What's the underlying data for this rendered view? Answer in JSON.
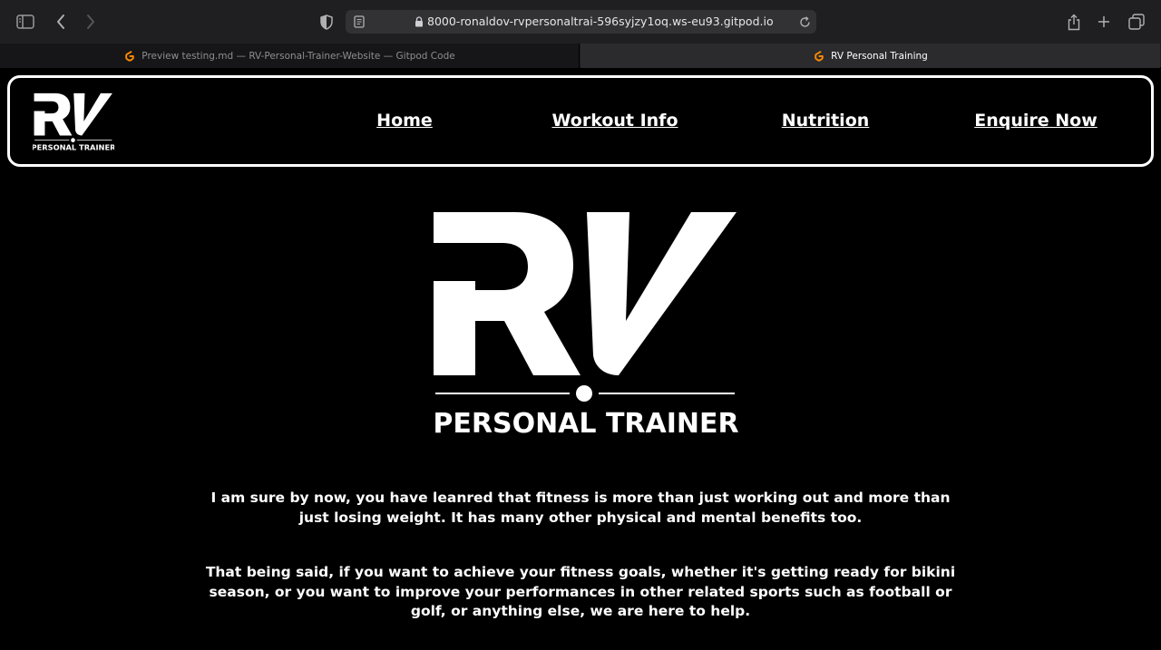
{
  "browser": {
    "url": "8000-ronaldov-rvpersonaltrai-596syjzy1oq.ws-eu93.gitpod.io",
    "tabs": [
      {
        "title": "Preview testing.md — RV-Personal-Trainer-Website — Gitpod Code",
        "active": false
      },
      {
        "title": "RV Personal Training",
        "active": true
      }
    ],
    "icons": [
      "sidebar-icon",
      "back-icon",
      "forward-icon",
      "privacy-shield-icon",
      "reader-icon",
      "lock-icon",
      "reload-icon",
      "share-icon",
      "new-tab-icon",
      "tab-overview-icon"
    ]
  },
  "site": {
    "logo": {
      "letters": "RV",
      "tagline": "PERSONAL TRAINER"
    },
    "nav": [
      "Home",
      "Workout Info",
      "Nutrition",
      "Enquire Now"
    ],
    "paragraphs": [
      [
        "I am sure by now, you have leanred that fitness is more than just working out and more than",
        "just losing weight. It has many other physical and mental benefits too."
      ],
      [
        "That being said, if you want to achieve your fitness goals, whether it's getting ready for bikini",
        "season, or you want to improve your performances in other related sports such as football or",
        "golf, or anything else, we are here to help."
      ]
    ]
  },
  "colors": {
    "page_bg": "#000000",
    "chrome_bg": "#1f1f21",
    "text": "#ffffff",
    "gitpod_orange": "#ff8a00"
  }
}
